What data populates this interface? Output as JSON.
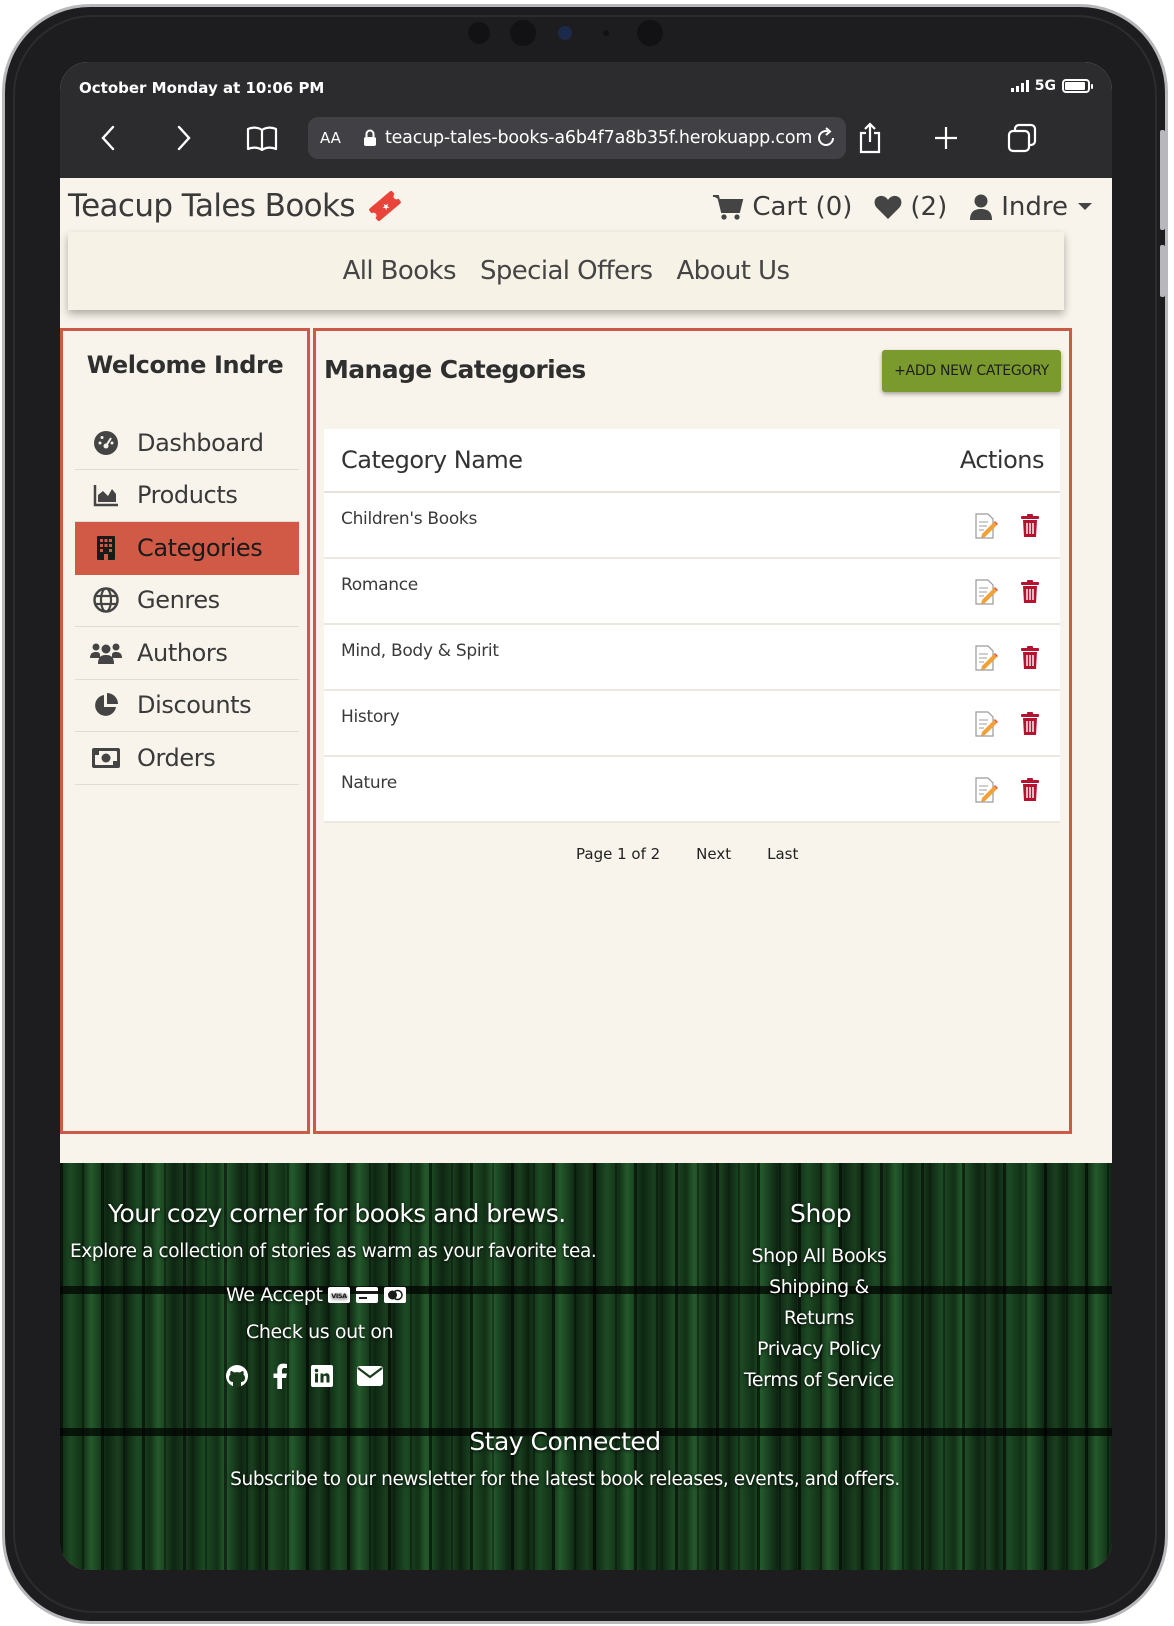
{
  "status_bar": {
    "time": "October Monday at 10:06 PM",
    "network": "5G"
  },
  "browser": {
    "aa_label": "AA",
    "url": "teacup-tales-books-a6b4f7a8b35f.herokuapp.com"
  },
  "header": {
    "brand": "Teacup Tales Books",
    "cart_label": "Cart (0)",
    "wishlist_label": "(2)",
    "user_label": "Indre"
  },
  "nav": {
    "items": [
      "All Books",
      "Special Offers",
      "About Us"
    ]
  },
  "sidebar": {
    "welcome": "Welcome Indre",
    "items": [
      {
        "label": "Dashboard",
        "icon": "gauge-icon"
      },
      {
        "label": "Products",
        "icon": "chart-area-icon"
      },
      {
        "label": "Categories",
        "icon": "building-icon"
      },
      {
        "label": "Genres",
        "icon": "globe-icon"
      },
      {
        "label": "Authors",
        "icon": "users-icon"
      },
      {
        "label": "Discounts",
        "icon": "pie-chart-icon"
      },
      {
        "label": "Orders",
        "icon": "money-bill-icon"
      }
    ],
    "active": "Categories"
  },
  "main": {
    "title": "Manage Categories",
    "add_button": "+ADD NEW CATEGORY",
    "table": {
      "headers": [
        "Category Name",
        "Actions"
      ],
      "rows": [
        "Children's Books",
        "Romance",
        "Mind, Body & Spirit",
        "History",
        "Nature"
      ]
    },
    "pagination": {
      "status": "Page 1 of 2",
      "next": "Next",
      "last": "Last"
    }
  },
  "footer": {
    "tagline": "Your cozy corner for books and brews.",
    "subtagline": "Explore a collection of stories as warm as your favorite tea.",
    "we_accept": "We Accept",
    "check_us_out": "Check us out on",
    "social": [
      "github-icon",
      "facebook-icon",
      "linkedin-icon",
      "envelope-icon"
    ],
    "shop_title": "Shop",
    "shop_links": [
      "Shop All Books",
      "Shipping & Returns",
      "Privacy Policy",
      "Terms of Service"
    ],
    "stay_connected": "Stay Connected",
    "newsletter_text": "Subscribe to our newsletter for the latest book releases, events, and offers."
  },
  "colors": {
    "accent": "#d05a45",
    "button": "#7b9a2d",
    "delete": "#b3132e",
    "background": "#f8f4eb"
  }
}
